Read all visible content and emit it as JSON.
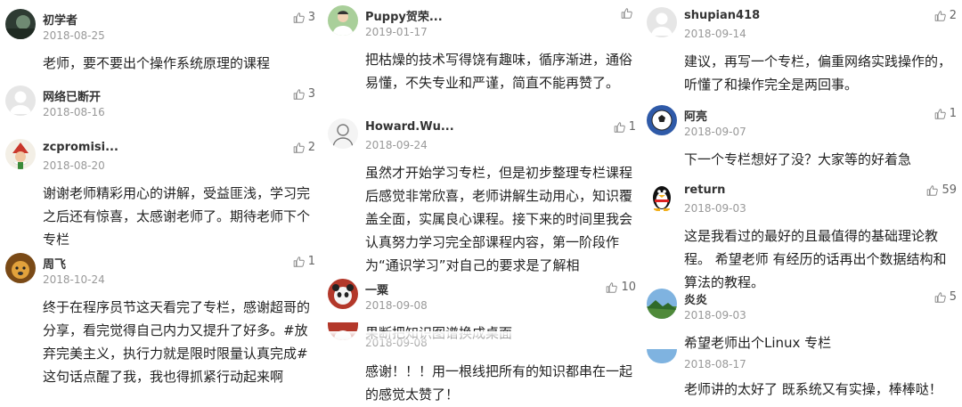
{
  "columns": [
    [
      {
        "user": "初学者",
        "date": "2018-08-25",
        "likes": "3",
        "text": "老师，要不要出个操作系统原理的课程",
        "avatar": "dark-portrait-icon",
        "avatar_color": "#3a4a3a"
      },
      {
        "user": "网络已断开",
        "date": "2018-08-16",
        "likes": "3",
        "text": "",
        "avatar": "default-avatar-icon",
        "avatar_color": "#e3e3e3"
      },
      {
        "user": "zcpromisi...",
        "date": "2018-08-20",
        "likes": "2",
        "text": "谢谢老师精彩用心的讲解，受益匪浅，学习完之后还有惊喜，太感谢老师了。期待老师下个专栏",
        "avatar": "santa-avatar-icon",
        "avatar_color": "#c94a3c"
      },
      {
        "user": "周飞",
        "date": "2018-10-24",
        "likes": "1",
        "text": "终于在程序员节这天看完了专栏，感谢超哥的分享，看完觉得自己内力又提升了好多。#放弃完美主义，执行力就是限时限量认真完成#这句话点醒了我，我也得抓紧行动起来啊",
        "avatar": "dog-avatar-icon",
        "avatar_color": "#c98a2a"
      }
    ],
    [
      {
        "user": "Puppy贺荣...",
        "date": "2019-01-17",
        "likes": "",
        "text": "把枯燥的技术写得饶有趣味，循序渐进，通俗易懂，不失专业和严谨，简直不能再赞了。",
        "avatar": "person-avatar-icon",
        "avatar_color": "#6a9a5a"
      },
      {
        "user": "Howard.Wu...",
        "date": "2018-09-24",
        "likes": "1",
        "text": "虽然才开始学习专栏，但是初步整理专栏课程后感觉非常欣喜，老师讲解生动用心，知识覆盖全面，实属良心课程。接下来的时间里我会认真努力学习完全部课程内容，第一阶段作为“通识学习”对自己的要求是了解相",
        "avatar": "sketch-avatar-icon",
        "avatar_color": "#eeeeee"
      },
      {
        "user": "一粟",
        "date": "2018-09-08",
        "likes": "10",
        "text": "果断把知识图谱换成桌面",
        "avatar": "panda-avatar-icon",
        "avatar_color": "#b33a2a"
      },
      {
        "user": "",
        "date": "2018-09-08",
        "likes": "",
        "text": "感谢！！！用一根线把所有的知识都串在一起的感觉太赞了！",
        "avatar": "panda-avatar-icon",
        "avatar_color": "#b33a2a"
      }
    ],
    [
      {
        "user": "shupian418",
        "date": "2018-09-14",
        "likes": "2",
        "text": "建议，再写一个专栏，偏重网络实践操作的，听懂了和操作完全是两回事。",
        "avatar": "default-avatar-icon",
        "avatar_color": "#e3e3e3"
      },
      {
        "user": "阿亮",
        "date": "2018-09-07",
        "likes": "1",
        "text": "下一个专栏想好了没？大家等的好着急",
        "avatar": "soccer-ball-avatar-icon",
        "avatar_color": "#3a5aa0"
      },
      {
        "user": "return",
        "date": "2018-09-03",
        "likes": "59",
        "text": "这是我看过的最好的且最值得的基础理论教程。 希望老师 有经历的话再出个数据结构和算法的教程。",
        "avatar": "penguin-avatar-icon",
        "avatar_color": "#111111"
      },
      {
        "user": "炎炎",
        "date": "2018-09-03",
        "likes": "5",
        "text": "希望老师出个Linux 专栏",
        "avatar": "landscape-avatar-icon",
        "avatar_color": "#5a8ac0"
      },
      {
        "user": "",
        "date": "2018-08-17",
        "likes": "",
        "text": "老师讲的太好了 既系统又有实操，棒棒哒！",
        "avatar": "landscape-avatar-icon",
        "avatar_color": "#5a8ac0"
      }
    ]
  ],
  "icons": {
    "like": "thumbs-up-icon"
  },
  "colors": {
    "username": "#333333",
    "date": "#999999",
    "text": "#222222",
    "like": "#666666"
  }
}
